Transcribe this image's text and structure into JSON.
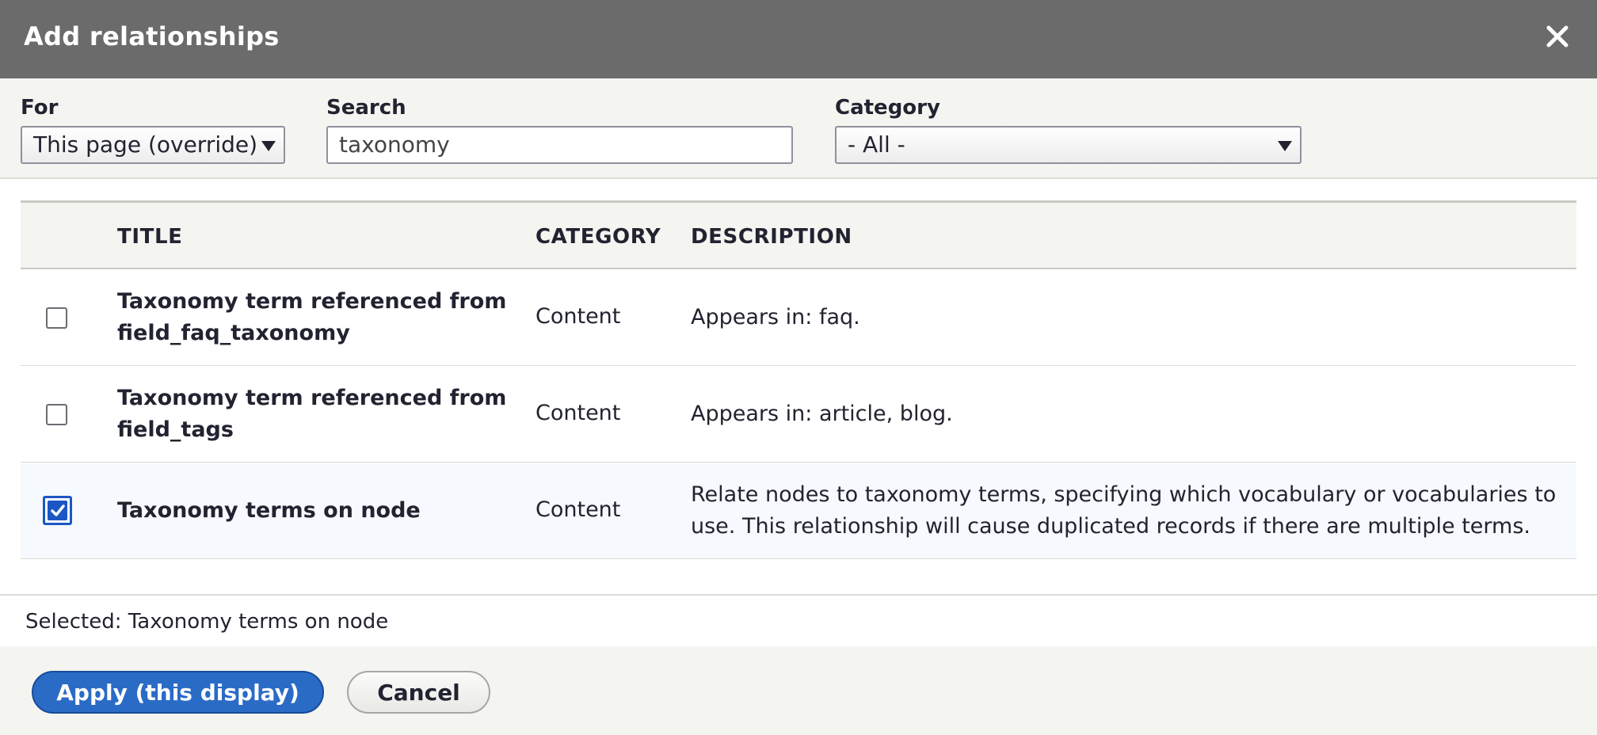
{
  "dialog": {
    "title": "Add relationships",
    "close_icon": "close-icon"
  },
  "filters": {
    "for_label": "For",
    "for_value": "This page (override)",
    "search_label": "Search",
    "search_value": "taxonomy",
    "category_label": "Category",
    "category_value": "- All -"
  },
  "table": {
    "headers": {
      "title": "TITLE",
      "category": "CATEGORY",
      "description": "DESCRIPTION"
    },
    "rows": [
      {
        "checked": false,
        "title": "Taxonomy term referenced from field_faq_taxonomy",
        "category": "Content",
        "description": "Appears in: faq."
      },
      {
        "checked": false,
        "title": "Taxonomy term referenced from field_tags",
        "category": "Content",
        "description": "Appears in: article, blog."
      },
      {
        "checked": true,
        "title": "Taxonomy terms on node",
        "category": "Content",
        "description": "Relate nodes to taxonomy terms, specifying which vocabulary or vocabularies to use. This relationship will cause duplicated records if there are multiple terms."
      }
    ]
  },
  "footer": {
    "selected_text": "Selected: Taxonomy terms on node",
    "apply_label": "Apply (this display)",
    "cancel_label": "Cancel"
  },
  "colors": {
    "titlebar": "#6b6b6b",
    "primary": "#2a6bc6",
    "checkbox_checked": "#1b56c4"
  }
}
